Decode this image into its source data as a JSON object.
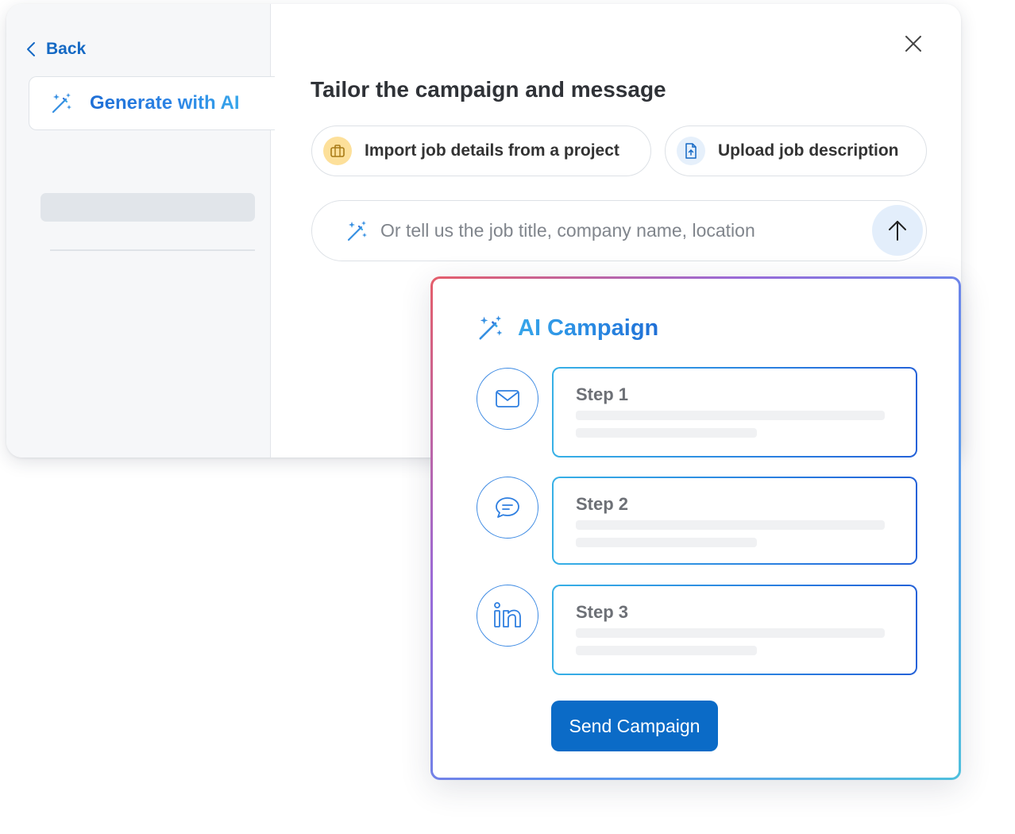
{
  "sidebar": {
    "back_label": "Back",
    "generate_tab_label": "Generate with AI"
  },
  "main": {
    "title": "Tailor the campaign and message",
    "import_chip_label": "Import job details from a project",
    "upload_chip_label": "Upload job description",
    "prompt_placeholder": "Or tell us the job title, company name, location"
  },
  "campaign": {
    "title": "AI Campaign",
    "steps": [
      {
        "label": "Step 1",
        "channel": "mail-icon"
      },
      {
        "label": "Step 2",
        "channel": "chat-bubble-icon"
      },
      {
        "label": "Step 3",
        "channel": "linkedin-icon"
      }
    ],
    "send_label": "Send Campaign"
  },
  "colors": {
    "accent": "#0b6bc7",
    "link": "#1569c4",
    "gradient_start": "#e55e6a",
    "gradient_end": "#4fc0dd",
    "chip_yellow": "#fde09a"
  }
}
